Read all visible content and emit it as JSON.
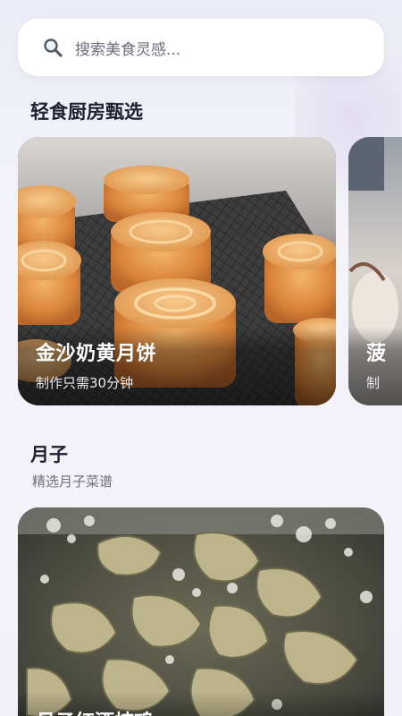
{
  "search": {
    "placeholder": "搜索美食灵感...",
    "icon": "search-icon"
  },
  "section_featured": {
    "title": "轻食厨房甄选"
  },
  "carousel": [
    {
      "title": "金沙奶黄月饼",
      "subtitle": "制作只需30分钟"
    },
    {
      "title": "菠",
      "subtitle": "制"
    }
  ],
  "section_confinement": {
    "title": "月子",
    "subtitle": "精选月子菜谱"
  },
  "recipes": [
    {
      "title": "月子红酒炖鸡"
    }
  ]
}
